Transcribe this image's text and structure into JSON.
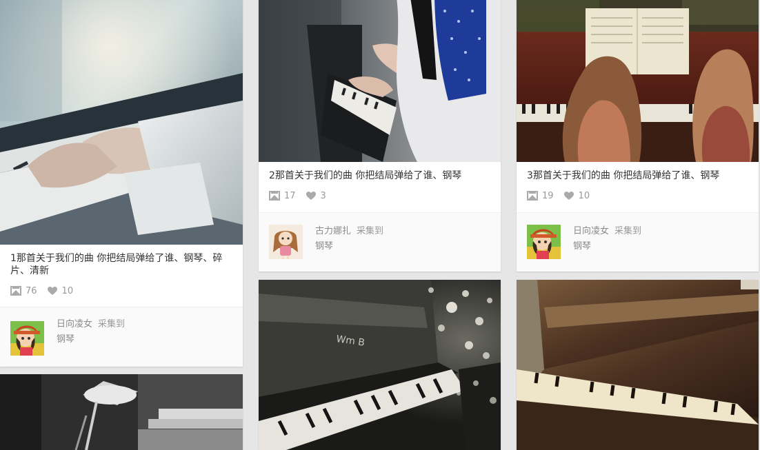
{
  "pins": [
    {
      "title": "1那首关于我们的曲 你把结局弹给了谁、钢琴、碎片、清新",
      "repins": "76",
      "likes": "10",
      "user": "日向凌女",
      "action": "采集到",
      "board": "钢琴",
      "avatar": "anime-girl-avatar"
    },
    {
      "title": "2那首关于我们的曲 你把结局弹给了谁、钢琴",
      "repins": "17",
      "likes": "3",
      "user": "古力娜扎",
      "action": "采集到",
      "board": "钢琴",
      "avatar": "chibi-girl-avatar"
    },
    {
      "title": "3那首关于我们的曲 你把结局弹给了谁、钢琴",
      "repins": "19",
      "likes": "10",
      "user": "日向凌女",
      "action": "采集到",
      "board": "钢琴",
      "avatar": "anime-girl-avatar"
    }
  ],
  "colors": {
    "background": "#e6e6e6",
    "card": "#ffffff",
    "footer": "#fafafa",
    "text": "#333333",
    "muted": "#999999"
  }
}
